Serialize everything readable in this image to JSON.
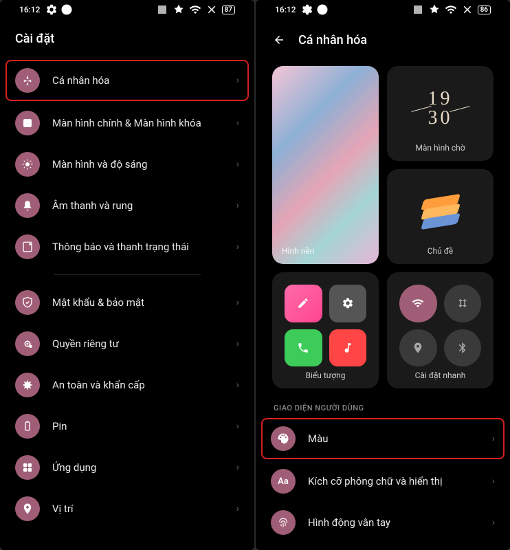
{
  "status": {
    "time": "16:12",
    "battery_left": "87",
    "battery_right": "86"
  },
  "left": {
    "header": "Cài đặt",
    "items": [
      {
        "label": "Cá nhân hóa"
      },
      {
        "label": "Màn hình chính & Màn hình khóa"
      },
      {
        "label": "Màn hình và độ sáng"
      },
      {
        "label": "Âm thanh và rung"
      },
      {
        "label": "Thông báo và thanh trạng thái"
      },
      {
        "label": "Mật khẩu & bảo mật"
      },
      {
        "label": "Quyền riêng tư"
      },
      {
        "label": "An toàn và khẩn cấp"
      },
      {
        "label": "Pin"
      },
      {
        "label": "Ứng dụng"
      },
      {
        "label": "Vị trí"
      }
    ]
  },
  "right": {
    "header": "Cá nhân hóa",
    "cards": {
      "wallpaper": "Hình nền",
      "aod": "Màn hình chờ",
      "theme": "Chủ đề",
      "icons": "Biểu tượng",
      "quick": "Cài đặt nhanh"
    },
    "clock_line1": "19",
    "clock_line2": "30",
    "section": "GIAO DIỆN NGƯỜI DÙNG",
    "items": [
      {
        "label": "Màu"
      },
      {
        "label": "Kích cỡ phông chữ và hiển thị"
      },
      {
        "label": "Hình động vân tay"
      }
    ]
  }
}
